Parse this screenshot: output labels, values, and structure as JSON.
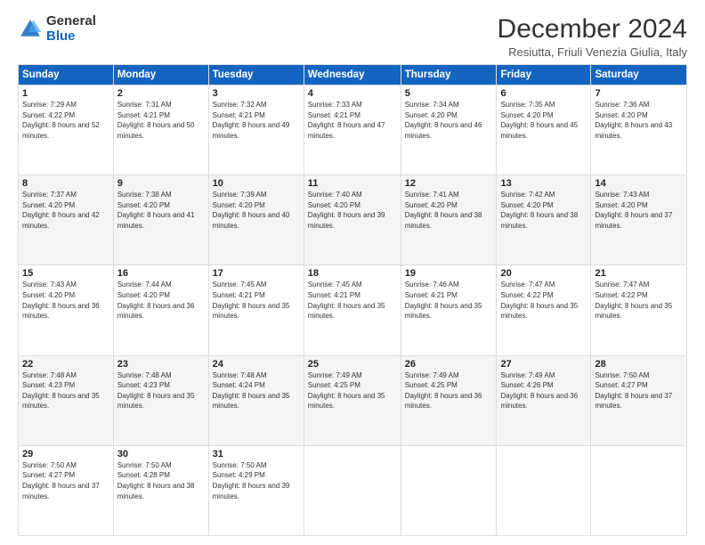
{
  "logo": {
    "general": "General",
    "blue": "Blue"
  },
  "title": "December 2024",
  "subtitle": "Resiutta, Friuli Venezia Giulia, Italy",
  "days_of_week": [
    "Sunday",
    "Monday",
    "Tuesday",
    "Wednesday",
    "Thursday",
    "Friday",
    "Saturday"
  ],
  "weeks": [
    [
      {
        "day": 1,
        "sunrise": "7:29 AM",
        "sunset": "4:22 PM",
        "daylight": "8 hours and 52 minutes."
      },
      {
        "day": 2,
        "sunrise": "7:31 AM",
        "sunset": "4:21 PM",
        "daylight": "8 hours and 50 minutes."
      },
      {
        "day": 3,
        "sunrise": "7:32 AM",
        "sunset": "4:21 PM",
        "daylight": "8 hours and 49 minutes."
      },
      {
        "day": 4,
        "sunrise": "7:33 AM",
        "sunset": "4:21 PM",
        "daylight": "8 hours and 47 minutes."
      },
      {
        "day": 5,
        "sunrise": "7:34 AM",
        "sunset": "4:20 PM",
        "daylight": "8 hours and 46 minutes."
      },
      {
        "day": 6,
        "sunrise": "7:35 AM",
        "sunset": "4:20 PM",
        "daylight": "8 hours and 45 minutes."
      },
      {
        "day": 7,
        "sunrise": "7:36 AM",
        "sunset": "4:20 PM",
        "daylight": "8 hours and 43 minutes."
      }
    ],
    [
      {
        "day": 8,
        "sunrise": "7:37 AM",
        "sunset": "4:20 PM",
        "daylight": "8 hours and 42 minutes."
      },
      {
        "day": 9,
        "sunrise": "7:38 AM",
        "sunset": "4:20 PM",
        "daylight": "8 hours and 41 minutes."
      },
      {
        "day": 10,
        "sunrise": "7:39 AM",
        "sunset": "4:20 PM",
        "daylight": "8 hours and 40 minutes."
      },
      {
        "day": 11,
        "sunrise": "7:40 AM",
        "sunset": "4:20 PM",
        "daylight": "8 hours and 39 minutes."
      },
      {
        "day": 12,
        "sunrise": "7:41 AM",
        "sunset": "4:20 PM",
        "daylight": "8 hours and 38 minutes."
      },
      {
        "day": 13,
        "sunrise": "7:42 AM",
        "sunset": "4:20 PM",
        "daylight": "8 hours and 38 minutes."
      },
      {
        "day": 14,
        "sunrise": "7:43 AM",
        "sunset": "4:20 PM",
        "daylight": "8 hours and 37 minutes."
      }
    ],
    [
      {
        "day": 15,
        "sunrise": "7:43 AM",
        "sunset": "4:20 PM",
        "daylight": "8 hours and 36 minutes."
      },
      {
        "day": 16,
        "sunrise": "7:44 AM",
        "sunset": "4:20 PM",
        "daylight": "8 hours and 36 minutes."
      },
      {
        "day": 17,
        "sunrise": "7:45 AM",
        "sunset": "4:21 PM",
        "daylight": "8 hours and 35 minutes."
      },
      {
        "day": 18,
        "sunrise": "7:45 AM",
        "sunset": "4:21 PM",
        "daylight": "8 hours and 35 minutes."
      },
      {
        "day": 19,
        "sunrise": "7:46 AM",
        "sunset": "4:21 PM",
        "daylight": "8 hours and 35 minutes."
      },
      {
        "day": 20,
        "sunrise": "7:47 AM",
        "sunset": "4:22 PM",
        "daylight": "8 hours and 35 minutes."
      },
      {
        "day": 21,
        "sunrise": "7:47 AM",
        "sunset": "4:22 PM",
        "daylight": "8 hours and 35 minutes."
      }
    ],
    [
      {
        "day": 22,
        "sunrise": "7:48 AM",
        "sunset": "4:23 PM",
        "daylight": "8 hours and 35 minutes."
      },
      {
        "day": 23,
        "sunrise": "7:48 AM",
        "sunset": "4:23 PM",
        "daylight": "8 hours and 35 minutes."
      },
      {
        "day": 24,
        "sunrise": "7:48 AM",
        "sunset": "4:24 PM",
        "daylight": "8 hours and 35 minutes."
      },
      {
        "day": 25,
        "sunrise": "7:49 AM",
        "sunset": "4:25 PM",
        "daylight": "8 hours and 35 minutes."
      },
      {
        "day": 26,
        "sunrise": "7:49 AM",
        "sunset": "4:25 PM",
        "daylight": "8 hours and 36 minutes."
      },
      {
        "day": 27,
        "sunrise": "7:49 AM",
        "sunset": "4:26 PM",
        "daylight": "8 hours and 36 minutes."
      },
      {
        "day": 28,
        "sunrise": "7:50 AM",
        "sunset": "4:27 PM",
        "daylight": "8 hours and 37 minutes."
      }
    ],
    [
      {
        "day": 29,
        "sunrise": "7:50 AM",
        "sunset": "4:27 PM",
        "daylight": "8 hours and 37 minutes."
      },
      {
        "day": 30,
        "sunrise": "7:50 AM",
        "sunset": "4:28 PM",
        "daylight": "8 hours and 38 minutes."
      },
      {
        "day": 31,
        "sunrise": "7:50 AM",
        "sunset": "4:29 PM",
        "daylight": "8 hours and 39 minutes."
      },
      null,
      null,
      null,
      null
    ]
  ],
  "labels": {
    "sunrise": "Sunrise:",
    "sunset": "Sunset:",
    "daylight": "Daylight:"
  }
}
